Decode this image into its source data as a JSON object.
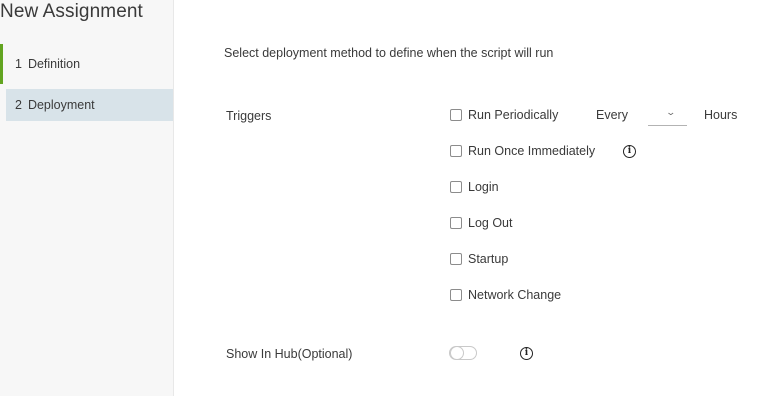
{
  "sidebar": {
    "title": "New Assignment",
    "steps": [
      {
        "number": "1",
        "label": "Definition"
      },
      {
        "number": "2",
        "label": "Deployment"
      }
    ]
  },
  "main": {
    "intro": "Select deployment method to define when the script will run",
    "triggers_label": "Triggers",
    "run_periodically": {
      "label": "Run Periodically",
      "every_label": "Every",
      "interval_value": "",
      "hours_label": "Hours"
    },
    "triggers": [
      {
        "label": "Run Once Immediately"
      },
      {
        "label": "Login"
      },
      {
        "label": "Log Out"
      },
      {
        "label": "Startup"
      },
      {
        "label": "Network Change"
      }
    ],
    "show_in_hub_label": "Show In Hub(Optional)",
    "info_glyph": "i"
  },
  "colors": {
    "active_step_bg": "#d8e3e9",
    "step_accent": "#62a420"
  }
}
